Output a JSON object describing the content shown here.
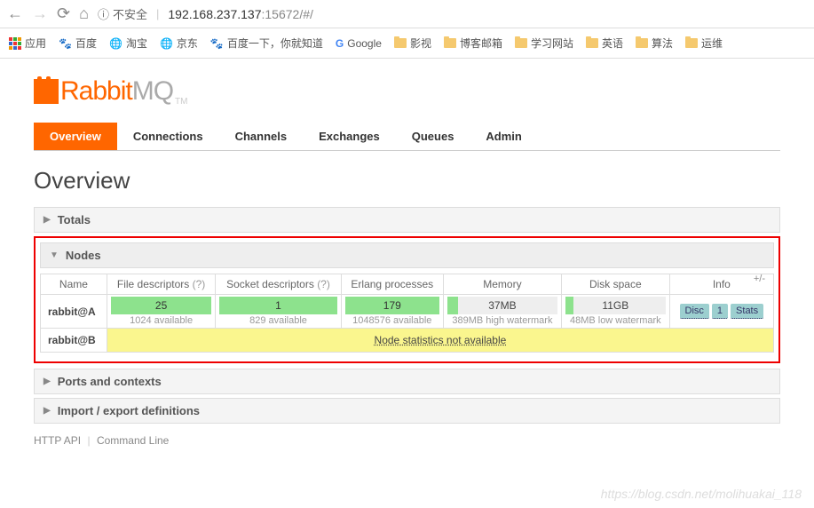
{
  "browser": {
    "insecure_label": "不安全",
    "url_host": "192.168.237.137",
    "url_port_path": ":15672/#/"
  },
  "bookmarks": {
    "apps": "应用",
    "items": [
      "百度",
      "淘宝",
      "京东",
      "百度一下，你就知道",
      "Google",
      "影视",
      "博客邮箱",
      "学习网站",
      "英语",
      "算法",
      "运维"
    ]
  },
  "logo": {
    "rabbit": "Rabbit",
    "mq": "MQ",
    "tm": "TM"
  },
  "tabs": [
    "Overview",
    "Connections",
    "Channels",
    "Exchanges",
    "Queues",
    "Admin"
  ],
  "heading": "Overview",
  "sections": {
    "totals": "Totals",
    "nodes": "Nodes",
    "ports": "Ports and contexts",
    "import": "Import / export definitions"
  },
  "table": {
    "plusminus": "+/-",
    "headers": {
      "name": "Name",
      "fd": "File descriptors",
      "sd": "Socket descriptors",
      "ep": "Erlang processes",
      "mem": "Memory",
      "disk": "Disk space",
      "info": "Info",
      "q": "(?)"
    },
    "rows": [
      {
        "name": "rabbit@A",
        "fd": {
          "val": "25",
          "sub": "1024 available"
        },
        "sd": {
          "val": "1",
          "sub": "829 available"
        },
        "ep": {
          "val": "179",
          "sub": "1048576 available"
        },
        "mem": {
          "val": "37MB",
          "sub": "389MB high watermark",
          "fill": 10
        },
        "disk": {
          "val": "11GB",
          "sub": "48MB low watermark",
          "fill": 8
        },
        "info": [
          "Disc",
          "1",
          "Stats"
        ]
      },
      {
        "name": "rabbit@B",
        "notavail": "Node statistics not available"
      }
    ]
  },
  "footer": {
    "api": "HTTP API",
    "cli": "Command Line"
  },
  "watermark": "https://blog.csdn.net/molihuakai_118"
}
